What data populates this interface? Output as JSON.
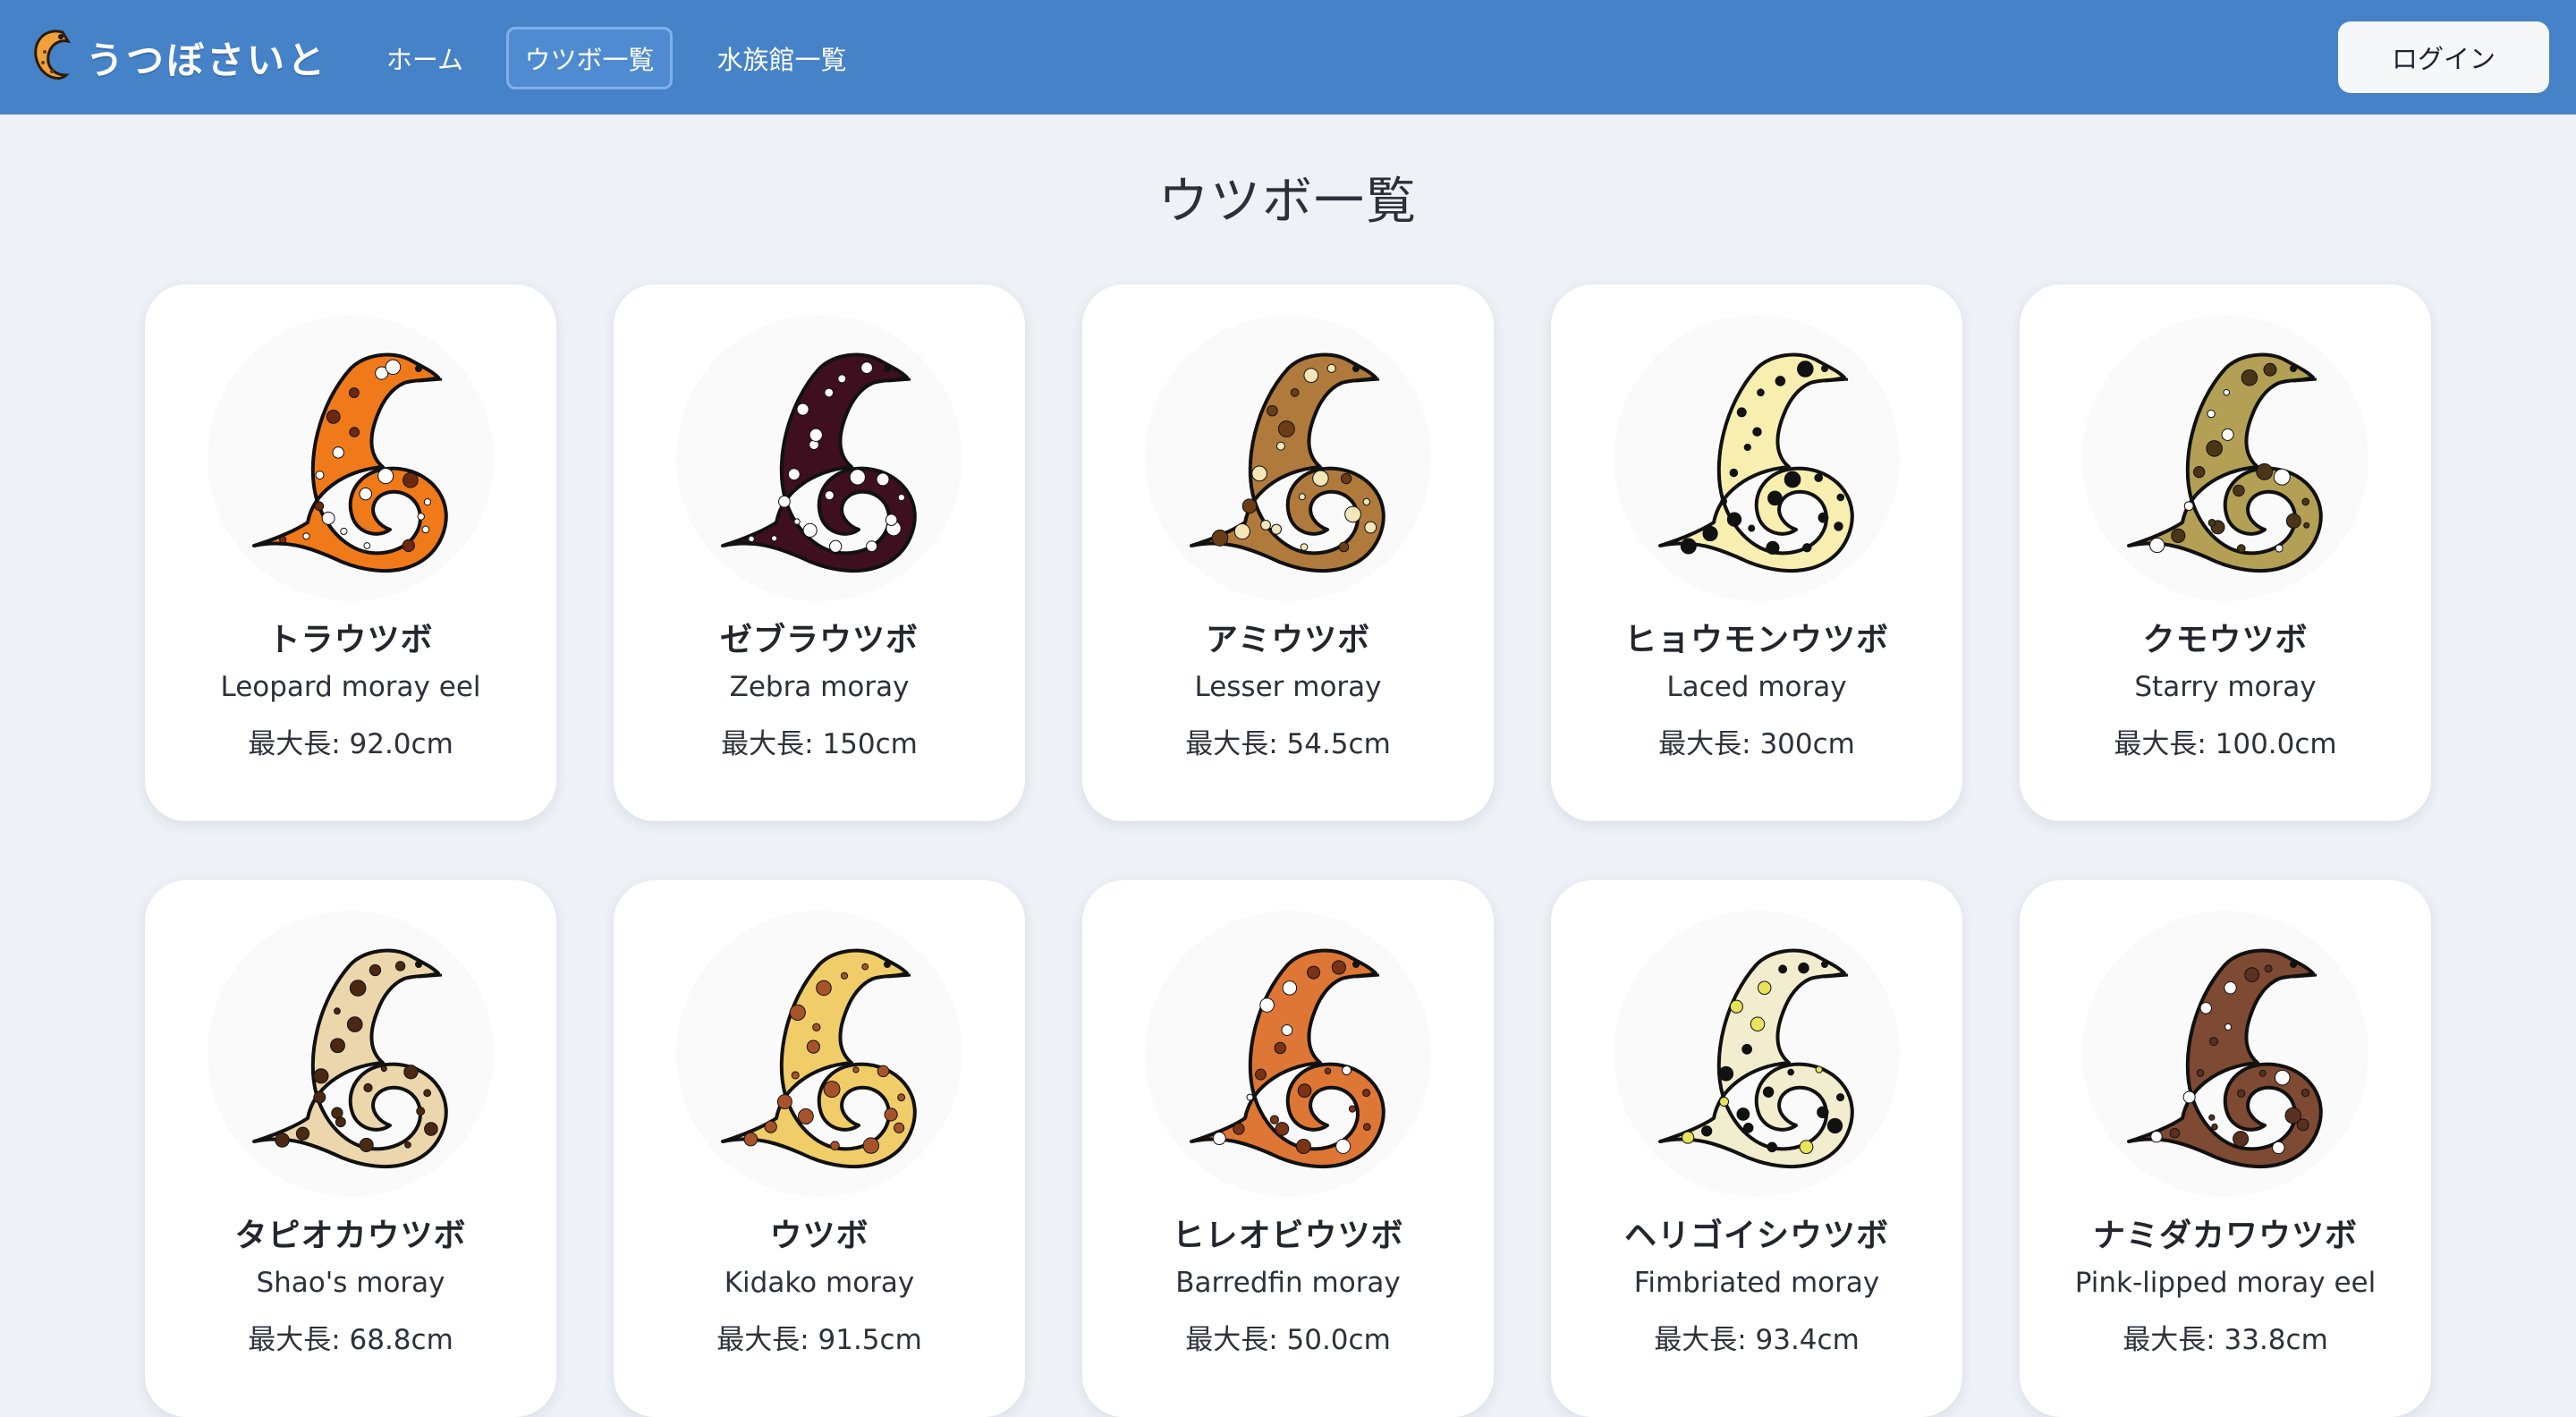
{
  "header": {
    "brand": "うつぼさいと",
    "brand_icon": "moray-eel-logo-icon",
    "nav": [
      {
        "label": "ホーム",
        "active": false
      },
      {
        "label": "ウツボ一覧",
        "active": true
      },
      {
        "label": "水族館一覧",
        "active": false
      }
    ],
    "login_label": "ログイン",
    "bar_color": "#4682c8"
  },
  "page": {
    "title": "ウツボ一覧"
  },
  "species": [
    {
      "name_ja": "トラウツボ",
      "name_en": "Leopard moray eel",
      "max_length": "最大長: 92.0cm",
      "icon": "leopard-moray-icon",
      "colors": {
        "body": "#f07a1a",
        "spot": "#ffffff",
        "spot2": "#6b2a10"
      }
    },
    {
      "name_ja": "ゼブラウツボ",
      "name_en": "Zebra moray",
      "max_length": "最大長: 150cm",
      "icon": "zebra-moray-icon",
      "colors": {
        "body": "#3d0f1f",
        "spot": "#ffffff",
        "spot2": "#ffffff"
      }
    },
    {
      "name_ja": "アミウツボ",
      "name_en": "Lesser moray",
      "max_length": "最大長: 54.5cm",
      "icon": "lesser-moray-icon",
      "colors": {
        "body": "#b07a3c",
        "spot": "#f3e6b8",
        "spot2": "#6a3d16"
      }
    },
    {
      "name_ja": "ヒョウモンウツボ",
      "name_en": "Laced moray",
      "max_length": "最大長: 300cm",
      "icon": "laced-moray-icon",
      "colors": {
        "body": "#f7eeb0",
        "spot": "#111111",
        "spot2": "#111111"
      }
    },
    {
      "name_ja": "クモウツボ",
      "name_en": "Starry moray",
      "max_length": "最大長: 100.0cm",
      "icon": "starry-moray-icon",
      "colors": {
        "body": "#b3a055",
        "spot": "#4a3516",
        "spot2": "#ffffff"
      }
    },
    {
      "name_ja": "タピオカウツボ",
      "name_en": "Shao's moray",
      "max_length": "最大長: 68.8cm",
      "icon": "shaos-moray-icon",
      "colors": {
        "body": "#ecd6ac",
        "spot": "#4a2812",
        "spot2": "#4a2812"
      }
    },
    {
      "name_ja": "ウツボ",
      "name_en": "Kidako moray",
      "max_length": "最大長: 91.5cm",
      "icon": "kidako-moray-icon",
      "colors": {
        "body": "#f0cd68",
        "spot": "#a7532a",
        "spot2": "#a7532a"
      }
    },
    {
      "name_ja": "ヒレオビウツボ",
      "name_en": "Barredfin moray",
      "max_length": "最大長: 50.0cm",
      "icon": "barredfin-moray-icon",
      "colors": {
        "body": "#de7636",
        "spot": "#7a3314",
        "spot2": "#ffffff"
      }
    },
    {
      "name_ja": "ヘリゴイシウツボ",
      "name_en": "Fimbriated moray",
      "max_length": "最大長: 93.4cm",
      "icon": "fimbriated-moray-icon",
      "colors": {
        "body": "#f3edcf",
        "spot": "#111111",
        "spot2": "#e8e35a"
      }
    },
    {
      "name_ja": "ナミダカワウツボ",
      "name_en": "Pink-lipped moray eel",
      "max_length": "最大長: 33.8cm",
      "icon": "pink-lipped-moray-icon",
      "colors": {
        "body": "#7e4a33",
        "spot": "#5a3020",
        "spot2": "#ffffff"
      }
    }
  ]
}
